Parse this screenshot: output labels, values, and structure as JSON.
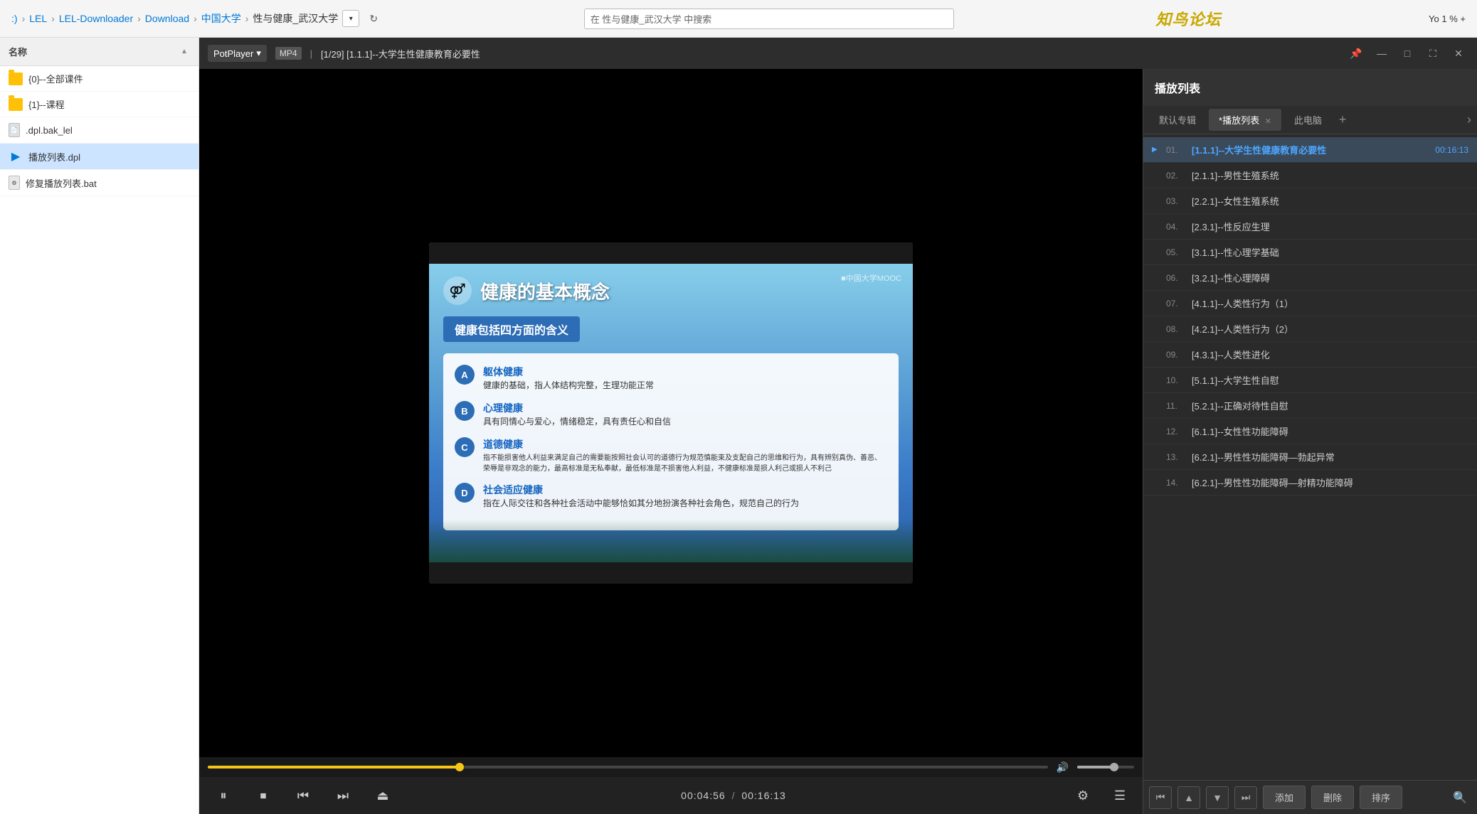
{
  "topbar": {
    "breadcrumb": [
      {
        "label": ":)",
        "id": "root"
      },
      {
        "label": "LEL",
        "id": "lel"
      },
      {
        "label": "LEL-Downloader",
        "id": "lel-downloader"
      },
      {
        "label": "Download",
        "id": "download"
      },
      {
        "label": "中国大学",
        "id": "zhongguo"
      },
      {
        "label": "性与健康_武汉大学",
        "id": "current"
      }
    ],
    "search_placeholder": "在 性与健康_武汉大学 中搜索",
    "brand": "知鸟论坛",
    "top_right": "Yo 1 % +"
  },
  "sidebar": {
    "header": "名称",
    "items": [
      {
        "label": "{0}--全部课件",
        "type": "folder",
        "id": "all-courses"
      },
      {
        "label": "{1}--课程",
        "type": "folder",
        "id": "course"
      },
      {
        "label": ".dpl.bak_lel",
        "type": "file",
        "id": "dpl-bak"
      },
      {
        "label": "播放列表.dpl",
        "type": "playlist",
        "id": "playlist-dpl"
      },
      {
        "label": "修复播放列表.bat",
        "type": "bat",
        "id": "repair-bat"
      }
    ]
  },
  "player": {
    "app": "PotPlayer",
    "format": "MP4",
    "title": "[1/29] [1.1.1]--大学生性健康教育必要性",
    "current_time": "00:04:56",
    "total_time": "00:16:13",
    "progress_percent": 30,
    "volume_percent": 65
  },
  "slide": {
    "main_title": "健康的基本概念",
    "watermark": "■中国大学MOOC",
    "subtitle": "健康包括四方面的含义",
    "icon": "⚤",
    "items": [
      {
        "letter": "A",
        "title": "躯体健康",
        "desc": "健康的基础，指人体结构完整，生理功能正常"
      },
      {
        "letter": "B",
        "title": "心理健康",
        "desc": "具有同情心与爱心，情绪稳定，具有责任心和自信"
      },
      {
        "letter": "C",
        "title": "道德健康",
        "desc": "指不能损害他人利益来满足自己的需要能按照社会认可的道德行为规范慎能束及支配自己的思维和行为，具有辨别真伪、善恶、荣辱是非观念的能力，最高标准是无私奉献，最低标准是不损害他人利益，不健康标准是损人利己或损人不利己"
      },
      {
        "letter": "D",
        "title": "社会适应健康",
        "desc": "指在人际交往和各种社会活动中能够恰如其分地扮演各种社会角色，规范自己的行为"
      }
    ]
  },
  "playlist_panel": {
    "title": "播放列表",
    "tabs": [
      {
        "label": "默认专辑",
        "active": false,
        "closable": false
      },
      {
        "label": "*播放列表",
        "active": true,
        "closable": true
      },
      {
        "label": "此电脑",
        "active": false,
        "closable": false
      }
    ],
    "add_label": "+",
    "items": [
      {
        "num": "01.",
        "title": "[1.1.1]--大学生性健康教育必要性",
        "duration": "00:16:13",
        "active": true
      },
      {
        "num": "02.",
        "title": "[2.1.1]--男性生殖系统",
        "duration": "",
        "active": false
      },
      {
        "num": "03.",
        "title": "[2.2.1]--女性生殖系统",
        "duration": "",
        "active": false
      },
      {
        "num": "04.",
        "title": "[2.3.1]--性反应生理",
        "duration": "",
        "active": false
      },
      {
        "num": "05.",
        "title": "[3.1.1]--性心理学基础",
        "duration": "",
        "active": false
      },
      {
        "num": "06.",
        "title": "[3.2.1]--性心理障碍",
        "duration": "",
        "active": false
      },
      {
        "num": "07.",
        "title": "[4.1.1]--人类性行为（1）",
        "duration": "",
        "active": false
      },
      {
        "num": "08.",
        "title": "[4.2.1]--人类性行为（2）",
        "duration": "",
        "active": false
      },
      {
        "num": "09.",
        "title": "[4.3.1]--人类性进化",
        "duration": "",
        "active": false
      },
      {
        "num": "10.",
        "title": "[5.1.1]--大学生性自慰",
        "duration": "",
        "active": false
      },
      {
        "num": "11.",
        "title": "[5.2.1]--正确对待性自慰",
        "duration": "",
        "active": false
      },
      {
        "num": "12.",
        "title": "[6.1.1]--女性性功能障碍",
        "duration": "",
        "active": false
      },
      {
        "num": "13.",
        "title": "[6.2.1]--男性性功能障碍—勃起异常",
        "duration": "",
        "active": false
      },
      {
        "num": "14.",
        "title": "[6.2.1]--男性性功能障碍—射精功能障碍",
        "duration": "",
        "active": false
      }
    ],
    "footer_buttons": [
      "▲▼",
      "▲",
      "▼",
      "▼▼"
    ],
    "add_btn": "添加",
    "delete_btn": "删除",
    "sort_btn": "排序"
  }
}
